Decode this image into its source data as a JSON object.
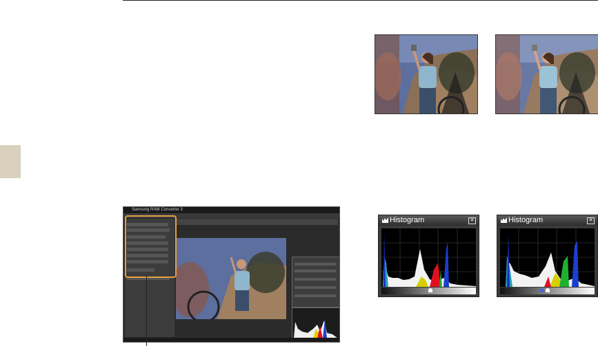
{
  "screenshot": {
    "window_title": "Samsung RAW Converter 3"
  },
  "histogram_before": {
    "title": "Histogram",
    "close": "✕"
  },
  "histogram_after": {
    "title": "Histogram",
    "close": "✕"
  },
  "colors": {
    "side_tab": "#d9d1bd",
    "highlight": "#e8a040",
    "sky": "#5c6f9e",
    "rock": "#a08060",
    "shirt": "#8fb6cc"
  }
}
